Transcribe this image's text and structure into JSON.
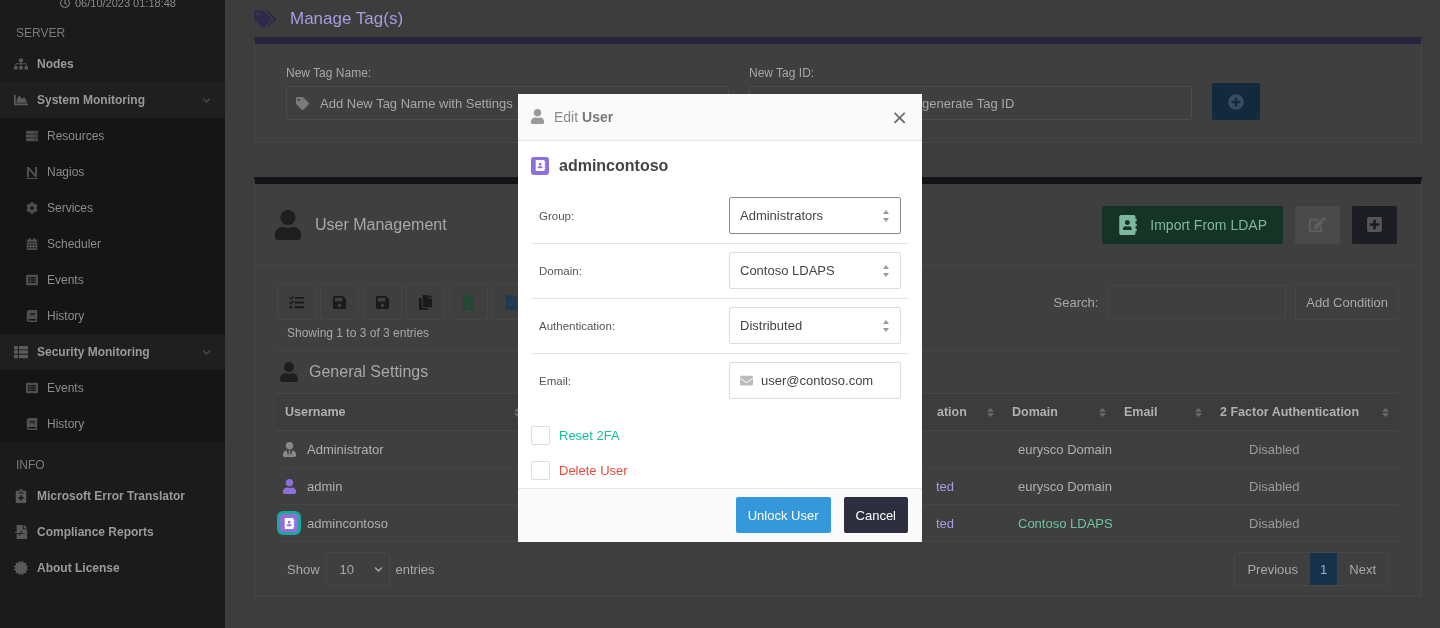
{
  "sidebar": {
    "timestamp": "06/10/2023 01:18:48",
    "sections": [
      {
        "title": "SERVER",
        "items": [
          {
            "label": "Nodes"
          },
          {
            "label": "System Monitoring",
            "expanded": true,
            "children": [
              {
                "label": "Resources"
              },
              {
                "label": "Nagios"
              },
              {
                "label": "Services"
              },
              {
                "label": "Scheduler"
              },
              {
                "label": "Events"
              },
              {
                "label": "History"
              }
            ]
          },
          {
            "label": "Security Monitoring",
            "expanded": true,
            "children": [
              {
                "label": "Events"
              },
              {
                "label": "History"
              }
            ]
          }
        ]
      },
      {
        "title": "INFO",
        "items": [
          {
            "label": "Microsoft Error Translator"
          },
          {
            "label": "Compliance Reports"
          },
          {
            "label": "About License"
          }
        ]
      }
    ]
  },
  "manage_tags": {
    "title": "Manage Tag(s)",
    "name_label": "New Tag Name:",
    "name_placeholder": "Add New Tag Name with Settings",
    "id_label": "New Tag ID:",
    "id_placeholder": "generate Tag ID"
  },
  "user_management": {
    "title": "User Management",
    "import_button": "Import From LDAP",
    "summary": "Showing 1 to 3 of 3 entries",
    "search_label": "Search:",
    "add_condition": "Add Condition",
    "section_title": "General Settings",
    "columns": [
      "Username",
      "ation",
      "Domain",
      "Email",
      "2 Factor Authentication"
    ],
    "rows": [
      {
        "selected": false,
        "cells": [
          "Administrator",
          "",
          "eurysco Domain",
          "",
          "Disabled"
        ],
        "domain_linked": false
      },
      {
        "selected": false,
        "cells": [
          "admin",
          "ted",
          "eurysco Domain",
          "",
          "Disabled"
        ],
        "domain_linked": false
      },
      {
        "selected": true,
        "cells": [
          "admincontoso",
          "ted",
          "Contoso LDAPS",
          "",
          "Disabled"
        ],
        "domain_linked": true
      }
    ],
    "show_label": "Show",
    "page_length": "10",
    "entries_label": "entries",
    "pagination": [
      {
        "label": "Previous",
        "selected": false
      },
      {
        "label": "1",
        "selected": true
      },
      {
        "label": "Next",
        "selected": false
      }
    ]
  },
  "modal": {
    "title": "Edit **User**",
    "close": "×",
    "username": "admincontoso",
    "fields": [
      {
        "label": "Group:",
        "kind": "select",
        "value": "Administrators",
        "focused": true
      },
      {
        "label": "Domain:",
        "kind": "select",
        "value": "Contoso LDAPS",
        "focused": false
      },
      {
        "label": "Authentication:",
        "kind": "select",
        "value": "Distributed",
        "focused": false
      },
      {
        "label": "Email:",
        "kind": "email",
        "value": "user@contoso.com",
        "focused": false
      }
    ],
    "checks": [
      {
        "label": "Reset 2FA",
        "checked": false,
        "color": "#1abc9c"
      },
      {
        "label": "Delete User",
        "checked": false,
        "color": "#e74c3c"
      }
    ],
    "buttons": [
      {
        "label": "Unlock User",
        "kind": "primary"
      },
      {
        "label": "Cancel",
        "kind": "dark"
      }
    ]
  }
}
